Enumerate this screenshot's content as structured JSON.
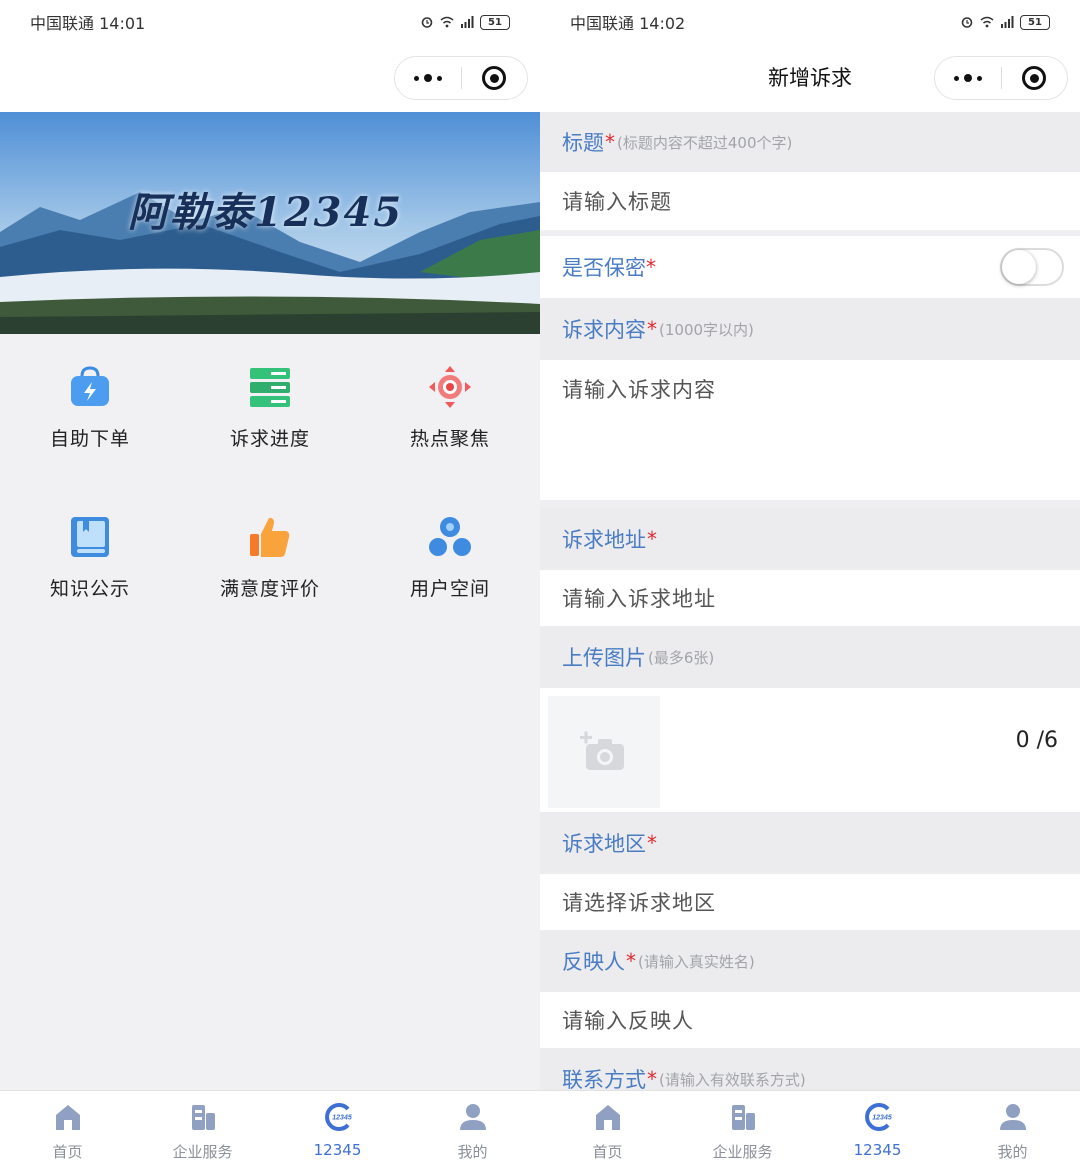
{
  "left": {
    "status": {
      "carrier_time": "中国联通 14:01",
      "battery": "51"
    },
    "banner": {
      "title": "阿勒泰12345"
    },
    "menu": [
      {
        "label": "自助下单",
        "icon": "quick-order-bag-icon"
      },
      {
        "label": "诉求进度",
        "icon": "progress-stack-icon"
      },
      {
        "label": "热点聚焦",
        "icon": "hotspot-target-icon"
      },
      {
        "label": "知识公示",
        "icon": "knowledge-book-icon"
      },
      {
        "label": "满意度评价",
        "icon": "thumbs-up-icon"
      },
      {
        "label": "用户空间",
        "icon": "user-space-icon"
      }
    ],
    "tabs": [
      {
        "label": "首页",
        "icon": "home-icon"
      },
      {
        "label": "企业服务",
        "icon": "building-icon"
      },
      {
        "label": "12345",
        "icon": "hotline-12345-icon",
        "active": true
      },
      {
        "label": "我的",
        "icon": "person-icon"
      }
    ]
  },
  "right": {
    "status": {
      "carrier_time": "中国联通 14:02",
      "battery": "51"
    },
    "nav": {
      "title": "新增诉求"
    },
    "form": {
      "title": {
        "label": "标题",
        "required": "*",
        "hint": "(标题内容不超过400个字)",
        "placeholder": "请输入标题"
      },
      "confidential": {
        "label": "是否保密",
        "required": "*",
        "value": false
      },
      "content": {
        "label": "诉求内容",
        "required": "*",
        "hint": "(1000字以内)",
        "placeholder": "请输入诉求内容"
      },
      "address": {
        "label": "诉求地址",
        "required": "*",
        "placeholder": "请输入诉求地址"
      },
      "images": {
        "label": "上传图片",
        "hint": "(最多6张)",
        "count": "0 /6"
      },
      "region": {
        "label": "诉求地区",
        "required": "*",
        "placeholder": "请选择诉求地区"
      },
      "reporter": {
        "label": "反映人",
        "required": "*",
        "hint": "(请输入真实姓名)",
        "placeholder": "请输入反映人"
      },
      "contact": {
        "label": "联系方式",
        "required": "*",
        "hint": "(请输入有效联系方式)"
      }
    },
    "tabs": [
      {
        "label": "首页",
        "icon": "home-icon"
      },
      {
        "label": "企业服务",
        "icon": "building-icon"
      },
      {
        "label": "12345",
        "icon": "hotline-12345-icon",
        "active": true
      },
      {
        "label": "我的",
        "icon": "person-icon"
      }
    ]
  },
  "colors": {
    "accent": "#3d6fd4",
    "label_blue": "#4a7cc4",
    "required_red": "#e0292f"
  }
}
